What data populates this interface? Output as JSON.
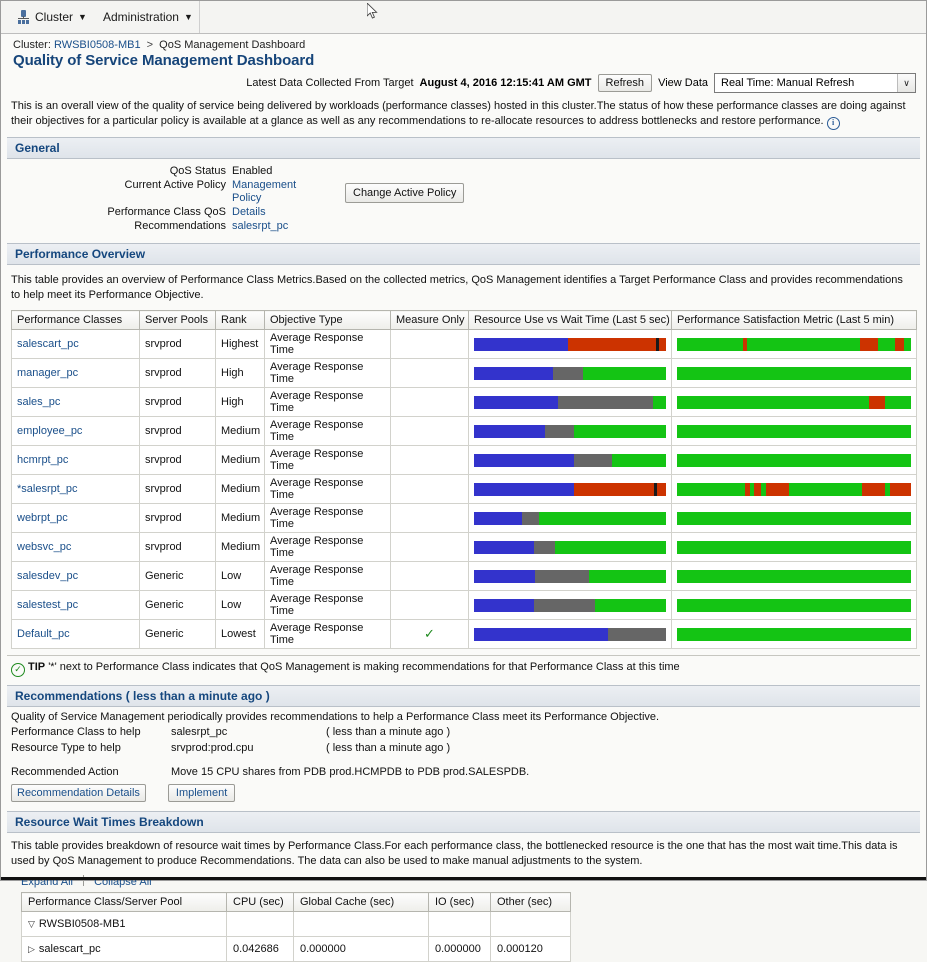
{
  "menubar": {
    "items": [
      {
        "label": "Cluster",
        "icon": "cluster-icon",
        "caret": "▼"
      },
      {
        "label": "Administration",
        "caret": "▼"
      }
    ]
  },
  "breadcrumb": {
    "cluster_label": "Cluster:",
    "cluster_name": "RWSBI0508-MB1",
    "separator": ">",
    "current": "QoS Management Dashboard"
  },
  "page_title": "Quality of Service Management Dashboard",
  "toolbar": {
    "latest_label": "Latest Data Collected From Target",
    "latest_value": "August 4, 2016 12:15:41 AM GMT",
    "refresh_label": "Refresh",
    "view_data_label": "View Data",
    "view_data_value": "Real Time: Manual Refresh",
    "view_data_options": [
      "Real Time: Manual Refresh"
    ],
    "select_arrow": "∨"
  },
  "intro": {
    "text": "This is an overall view of the quality of service being delivered by workloads (performance classes) hosted in this cluster.The status of how these performance classes are doing against their objectives for a particular policy is available at a glance as well as any recommendations to re-allocate resources to address bottlenecks and restore performance.",
    "info_icon": "i"
  },
  "general": {
    "header": "General",
    "rows": [
      {
        "label": "QoS Status",
        "value": "Enabled",
        "link": false
      },
      {
        "label": "Current Active Policy",
        "value": "Management Policy",
        "link": true
      },
      {
        "label": "Performance Class QoS",
        "value": "Details",
        "link": true
      },
      {
        "label": "Recommendations",
        "value": "salesrpt_pc",
        "link": true
      }
    ],
    "change_policy_button": "Change Active Policy"
  },
  "performance_overview": {
    "header": "Performance Overview",
    "description": "This table provides an overview of Performance Class Metrics.Based on the collected metrics, QoS Management identifies a Target Performance Class and provides recommendations to help meet its Performance Objective.",
    "columns": [
      "Performance Classes",
      "Server Pools",
      "Rank",
      "Objective Type",
      "Measure Only",
      "Resource Use vs Wait Time (Last 5 sec)",
      "Performance Satisfaction Metric (Last 5 min)"
    ],
    "check_glyph": "✓",
    "rows": [
      {
        "name": "salescart_pc",
        "pool": "srvprod",
        "rank": "Highest",
        "objective": "Average Response Time",
        "measure_only": false,
        "resource_bar": [
          {
            "color": "#3333cc",
            "pct": 49
          },
          {
            "color": "#cc3300",
            "pct": 46
          },
          {
            "color": "#1a1a1a",
            "pct": 1.5
          },
          {
            "color": "#cc3300",
            "pct": 3.5
          }
        ],
        "psm_bar": [
          {
            "color": "#14c414",
            "pct": 28
          },
          {
            "color": "#cc3300",
            "pct": 2
          },
          {
            "color": "#14c414",
            "pct": 48
          },
          {
            "color": "#cc3300",
            "pct": 8
          },
          {
            "color": "#14c414",
            "pct": 7
          },
          {
            "color": "#cc3300",
            "pct": 4
          },
          {
            "color": "#14c414",
            "pct": 3
          }
        ]
      },
      {
        "name": "manager_pc",
        "pool": "srvprod",
        "rank": "High",
        "objective": "Average Response Time",
        "measure_only": false,
        "resource_bar": [
          {
            "color": "#3333cc",
            "pct": 41
          },
          {
            "color": "#666666",
            "pct": 16
          },
          {
            "color": "#14c414",
            "pct": 43
          }
        ],
        "psm_bar": [
          {
            "color": "#14c414",
            "pct": 100
          }
        ]
      },
      {
        "name": "sales_pc",
        "pool": "srvprod",
        "rank": "High",
        "objective": "Average Response Time",
        "measure_only": false,
        "resource_bar": [
          {
            "color": "#3333cc",
            "pct": 44
          },
          {
            "color": "#666666",
            "pct": 49
          },
          {
            "color": "#14c414",
            "pct": 7
          }
        ],
        "psm_bar": [
          {
            "color": "#14c414",
            "pct": 82
          },
          {
            "color": "#cc3300",
            "pct": 7
          },
          {
            "color": "#14c414",
            "pct": 11
          }
        ]
      },
      {
        "name": "employee_pc",
        "pool": "srvprod",
        "rank": "Medium",
        "objective": "Average Response Time",
        "measure_only": false,
        "resource_bar": [
          {
            "color": "#3333cc",
            "pct": 37
          },
          {
            "color": "#666666",
            "pct": 15
          },
          {
            "color": "#14c414",
            "pct": 48
          }
        ],
        "psm_bar": [
          {
            "color": "#14c414",
            "pct": 100
          }
        ]
      },
      {
        "name": "hcmrpt_pc",
        "pool": "srvprod",
        "rank": "Medium",
        "objective": "Average Response Time",
        "measure_only": false,
        "resource_bar": [
          {
            "color": "#3333cc",
            "pct": 52
          },
          {
            "color": "#666666",
            "pct": 20
          },
          {
            "color": "#14c414",
            "pct": 28
          }
        ],
        "psm_bar": [
          {
            "color": "#14c414",
            "pct": 100
          }
        ]
      },
      {
        "name": "*salesrpt_pc",
        "pool": "srvprod",
        "rank": "Medium",
        "objective": "Average Response Time",
        "measure_only": false,
        "resource_bar": [
          {
            "color": "#3333cc",
            "pct": 52
          },
          {
            "color": "#cc3300",
            "pct": 42
          },
          {
            "color": "#1a1a1a",
            "pct": 1.5
          },
          {
            "color": "#cc3300",
            "pct": 4.5
          }
        ],
        "psm_bar": [
          {
            "color": "#14c414",
            "pct": 29
          },
          {
            "color": "#cc3300",
            "pct": 2
          },
          {
            "color": "#14c414",
            "pct": 2
          },
          {
            "color": "#cc3300",
            "pct": 3
          },
          {
            "color": "#14c414",
            "pct": 2
          },
          {
            "color": "#cc3300",
            "pct": 10
          },
          {
            "color": "#14c414",
            "pct": 31
          },
          {
            "color": "#cc3300",
            "pct": 10
          },
          {
            "color": "#14c414",
            "pct": 2
          },
          {
            "color": "#cc3300",
            "pct": 9
          }
        ]
      },
      {
        "name": "webrpt_pc",
        "pool": "srvprod",
        "rank": "Medium",
        "objective": "Average Response Time",
        "measure_only": false,
        "resource_bar": [
          {
            "color": "#3333cc",
            "pct": 25
          },
          {
            "color": "#666666",
            "pct": 9
          },
          {
            "color": "#14c414",
            "pct": 66
          }
        ],
        "psm_bar": [
          {
            "color": "#14c414",
            "pct": 100
          }
        ]
      },
      {
        "name": "websvc_pc",
        "pool": "srvprod",
        "rank": "Medium",
        "objective": "Average Response Time",
        "measure_only": false,
        "resource_bar": [
          {
            "color": "#3333cc",
            "pct": 31
          },
          {
            "color": "#666666",
            "pct": 11
          },
          {
            "color": "#14c414",
            "pct": 58
          }
        ],
        "psm_bar": [
          {
            "color": "#14c414",
            "pct": 100
          }
        ]
      },
      {
        "name": "salesdev_pc",
        "pool": "Generic",
        "rank": "Low",
        "objective": "Average Response Time",
        "measure_only": false,
        "resource_bar": [
          {
            "color": "#3333cc",
            "pct": 32
          },
          {
            "color": "#666666",
            "pct": 28
          },
          {
            "color": "#14c414",
            "pct": 40
          }
        ],
        "psm_bar": [
          {
            "color": "#14c414",
            "pct": 100
          }
        ]
      },
      {
        "name": "salestest_pc",
        "pool": "Generic",
        "rank": "Low",
        "objective": "Average Response Time",
        "measure_only": false,
        "resource_bar": [
          {
            "color": "#3333cc",
            "pct": 31
          },
          {
            "color": "#666666",
            "pct": 32
          },
          {
            "color": "#14c414",
            "pct": 37
          }
        ],
        "psm_bar": [
          {
            "color": "#14c414",
            "pct": 100
          }
        ]
      },
      {
        "name": "Default_pc",
        "pool": "Generic",
        "rank": "Lowest",
        "objective": "Average Response Time",
        "measure_only": true,
        "resource_bar": [
          {
            "color": "#3333cc",
            "pct": 70
          },
          {
            "color": "#666666",
            "pct": 30
          }
        ],
        "psm_bar": [
          {
            "color": "#14c414",
            "pct": 100
          }
        ]
      }
    ]
  },
  "tip": {
    "icon": "✓",
    "strong": "TIP",
    "text": "'*' next to Performance Class indicates that QoS Management is making recommendations for that Performance Class at this time"
  },
  "recommendations": {
    "header": "Recommendations ( less than a minute ago )",
    "description": "Quality of Service Management periodically provides recommendations to help a Performance Class meet its Performance Objective.",
    "rows": [
      {
        "label": "Performance Class to help",
        "value": "salesrpt_pc",
        "age": "( less than a minute ago )"
      },
      {
        "label": "Resource Type to help",
        "value": "srvprod:prod.cpu",
        "age": "( less than a minute ago )"
      }
    ],
    "action_label": "Recommended Action",
    "action_value": "Move 15 CPU shares from PDB prod.HCMPDB to PDB prod.SALESPDB.",
    "details_button": "Recommendation Details",
    "implement_button": "Implement"
  },
  "resource_wait": {
    "header": "Resource Wait Times Breakdown",
    "description": "This table provides breakdown of resource wait times by Performance Class.For each performance class, the bottlenecked resource is the one that has the most wait time.This data is used by QoS Management to produce Recommendations. The data can also be used to make manual adjustments to the system.",
    "expand_all": "Expand All",
    "collapse_all": "Collapse All",
    "columns": [
      "Performance Class/Server Pool",
      "CPU (sec)",
      "Global Cache (sec)",
      "IO (sec)",
      "Other (sec)"
    ],
    "rows": [
      {
        "twisty": "▽",
        "indent": 1,
        "name": "RWSBI0508-MB1",
        "cpu": "",
        "gc": "",
        "io": "",
        "other": ""
      },
      {
        "twisty": "▷",
        "indent": 2,
        "name": "salescart_pc",
        "cpu": "0.042686",
        "gc": "0.000000",
        "io": "0.000000",
        "other": "0.000120"
      }
    ]
  }
}
